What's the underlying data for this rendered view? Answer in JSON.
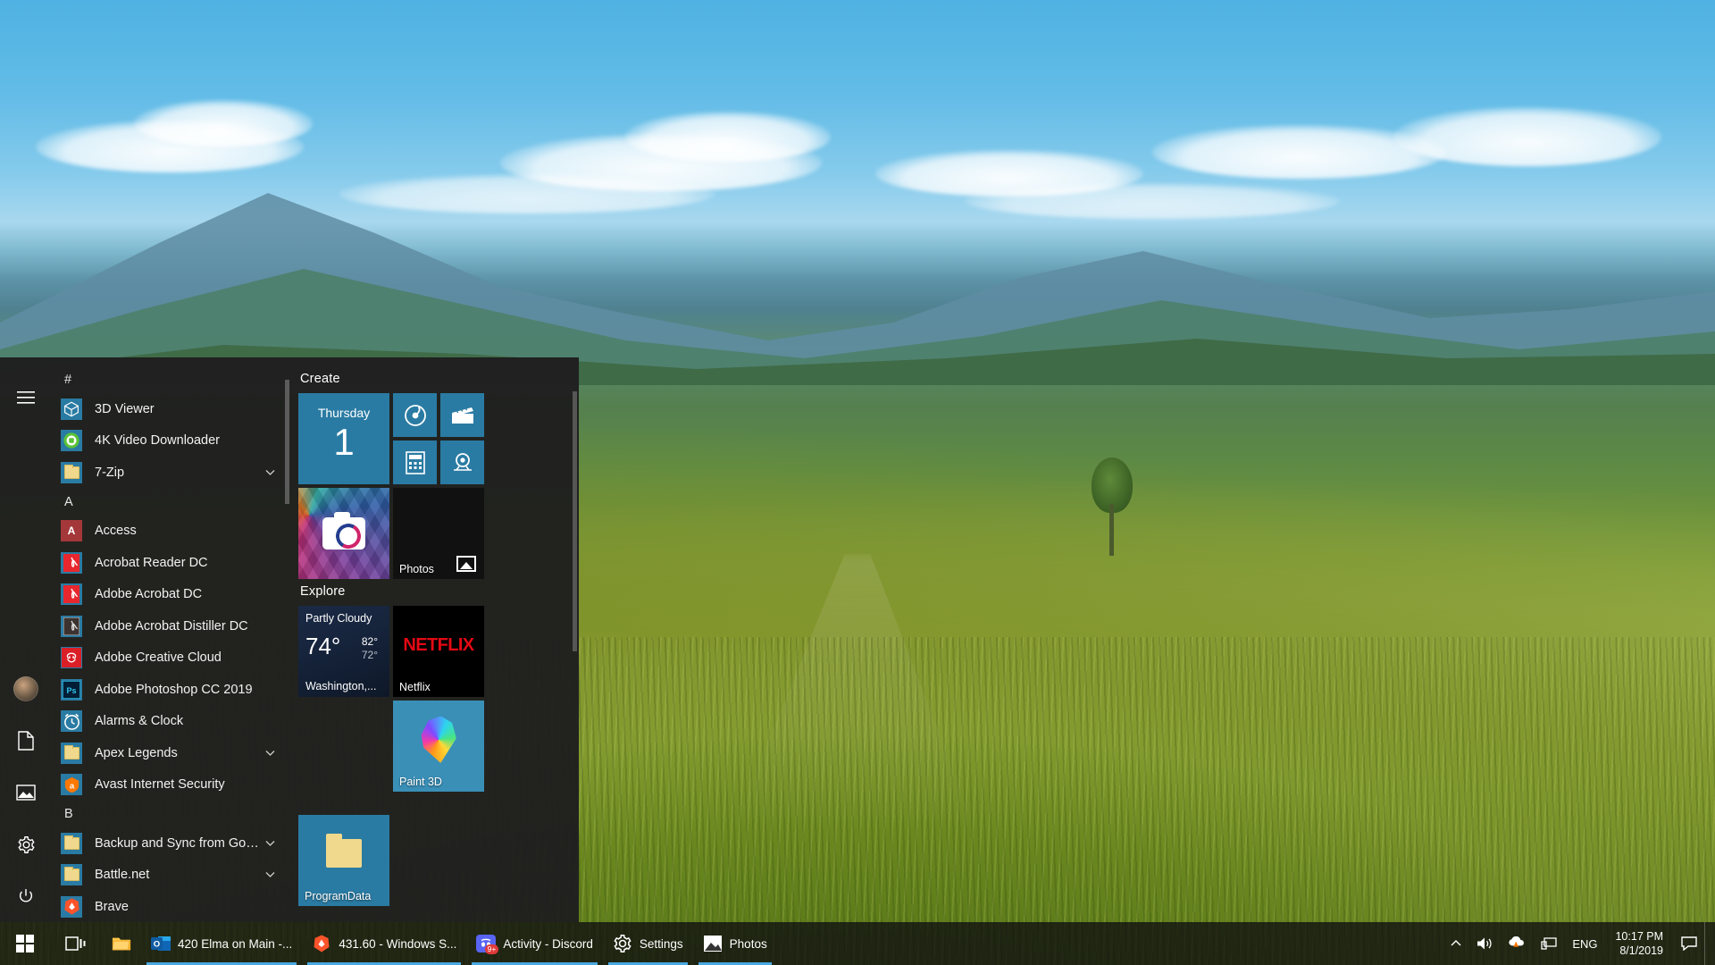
{
  "desktop": {
    "wallpaper_description": "green hills landscape with mountains and blue sky"
  },
  "start_menu": {
    "rail": [
      {
        "name": "hamburger",
        "icon": "hamburger-icon"
      },
      {
        "name": "user",
        "icon": "user-avatar-icon"
      },
      {
        "name": "documents",
        "icon": "document-icon"
      },
      {
        "name": "pictures",
        "icon": "picture-icon"
      },
      {
        "name": "settings",
        "icon": "gear-icon"
      },
      {
        "name": "power",
        "icon": "power-icon"
      }
    ],
    "app_list": [
      {
        "type": "letter",
        "label": "#"
      },
      {
        "type": "app",
        "label": "3D Viewer",
        "icon": "cube-icon",
        "expandable": false
      },
      {
        "type": "app",
        "label": "4K Video Downloader",
        "icon": "download-cloud-icon",
        "expandable": false
      },
      {
        "type": "app",
        "label": "7-Zip",
        "icon": "folder-icon",
        "expandable": true
      },
      {
        "type": "letter",
        "label": "A"
      },
      {
        "type": "app",
        "label": "Access",
        "icon": "access-icon",
        "expandable": false
      },
      {
        "type": "app",
        "label": "Acrobat Reader DC",
        "icon": "pdf-icon",
        "expandable": false
      },
      {
        "type": "app",
        "label": "Adobe Acrobat DC",
        "icon": "pdf-icon",
        "expandable": false
      },
      {
        "type": "app",
        "label": "Adobe Acrobat Distiller DC",
        "icon": "pdf-dark-icon",
        "expandable": false
      },
      {
        "type": "app",
        "label": "Adobe Creative Cloud",
        "icon": "creative-cloud-icon",
        "expandable": false
      },
      {
        "type": "app",
        "label": "Adobe Photoshop CC 2019",
        "icon": "photoshop-icon",
        "expandable": false
      },
      {
        "type": "app",
        "label": "Alarms & Clock",
        "icon": "alarm-clock-icon",
        "expandable": false
      },
      {
        "type": "app",
        "label": "Apex Legends",
        "icon": "folder-icon",
        "expandable": true
      },
      {
        "type": "app",
        "label": "Avast Internet Security",
        "icon": "avast-icon",
        "expandable": false
      },
      {
        "type": "letter",
        "label": "B"
      },
      {
        "type": "app",
        "label": "Backup and Sync from Google",
        "icon": "folder-icon",
        "expandable": true
      },
      {
        "type": "app",
        "label": "Battle.net",
        "icon": "folder-icon",
        "expandable": true
      },
      {
        "type": "app",
        "label": "Brave",
        "icon": "brave-icon",
        "expandable": false
      }
    ],
    "tile_groups": [
      {
        "title": "Create",
        "tiles": [
          {
            "name": "Calendar",
            "kind": "calendar",
            "day": "Thursday",
            "date": "1",
            "show_label": false
          },
          {
            "name": "Groove Music",
            "kind": "small",
            "icon": "groove-music-icon",
            "show_label": false
          },
          {
            "name": "Movies & TV",
            "kind": "small",
            "icon": "film-clapper-icon",
            "show_label": false
          },
          {
            "name": "Calculator",
            "kind": "small",
            "icon": "calculator-icon",
            "show_label": false
          },
          {
            "name": "Maps",
            "kind": "small",
            "icon": "map-pin-icon",
            "show_label": false
          },
          {
            "name": "Camera",
            "kind": "camera",
            "icon": "camera-icon",
            "show_label": false
          },
          {
            "name": "Photos",
            "label": "Photos",
            "kind": "photos",
            "icon": "photos-icon",
            "show_label": true
          },
          {
            "name": "Picture",
            "kind": "picture",
            "icon": "picture-icon",
            "show_label": false
          }
        ]
      },
      {
        "title": "Explore",
        "tiles": [
          {
            "name": "Weather",
            "kind": "weather",
            "condition": "Partly Cloudy",
            "temp": "74°",
            "high": "82°",
            "low": "72°",
            "location": "Washington,...",
            "show_label": false
          },
          {
            "name": "Netflix",
            "label": "Netflix",
            "kind": "netflix",
            "logo": "NETFLIX",
            "show_label": true
          },
          {
            "name": "Paint 3D",
            "label": "Paint 3D",
            "kind": "paint3d",
            "show_label": true
          },
          {
            "name": "ProgramData",
            "label": "ProgramData",
            "kind": "folder",
            "show_label": true
          }
        ]
      }
    ]
  },
  "taskbar": {
    "start_label": "Start",
    "task_view_label": "Task View",
    "items": [
      {
        "label": "",
        "icon": "file-explorer-icon",
        "pinned": true,
        "active": false,
        "running": false
      },
      {
        "label": "420 Elma on Main -...",
        "icon": "outlook-icon",
        "pinned": false,
        "active": false,
        "running": true
      },
      {
        "label": "431.60 - Windows S...",
        "icon": "brave-icon",
        "pinned": false,
        "active": false,
        "running": true
      },
      {
        "label": "Activity - Discord",
        "icon": "discord-icon",
        "badge": "9+",
        "pinned": false,
        "active": false,
        "running": true
      },
      {
        "label": "Settings",
        "icon": "gear-icon",
        "pinned": false,
        "active": false,
        "running": true
      },
      {
        "label": "Photos",
        "icon": "photos-icon",
        "pinned": false,
        "active": false,
        "running": true
      }
    ],
    "tray": {
      "chevron_label": "Show hidden icons",
      "icons": [
        {
          "name": "volume-icon"
        },
        {
          "name": "avast-shield-icon"
        },
        {
          "name": "network-icon"
        }
      ],
      "language": "ENG",
      "time": "10:17 PM",
      "date": "8/1/2019",
      "action_center": "action-center-icon"
    }
  },
  "colors": {
    "accent": "#2a7ba3",
    "taskbar": "rgba(16,16,16,0.80)",
    "start_bg": "rgba(31,31,31,0.97)",
    "netflix_red": "#e50914",
    "active_underline": "#4aa8e0"
  }
}
